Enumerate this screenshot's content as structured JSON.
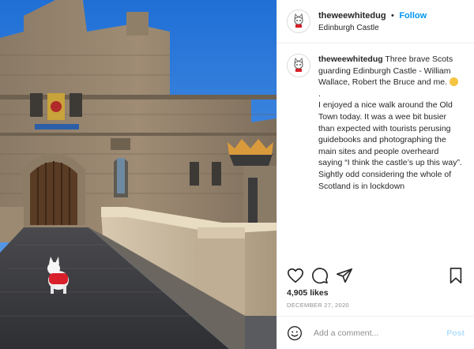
{
  "header": {
    "username": "theweewhitedug",
    "separator": "•",
    "follow_label": "Follow",
    "location": "Edinburgh Castle"
  },
  "caption": {
    "username": "theweewhitedug",
    "line1": "Three brave Scots guarding Edinburgh Castle - William Wallace, Robert the Bruce and me.",
    "line2": ".",
    "line3": "I enjoyed a nice walk around the Old Town today. It was a wee bit busier than expected with tourists perusing guidebooks and photographing the main sites and people overheard saying “I think the castle’s up this way”. Sightly odd considering the whole of Scotland is in lockdown"
  },
  "actions": {
    "icons": [
      "heart-icon",
      "comment-icon",
      "share-icon",
      "bookmark-icon"
    ]
  },
  "likes": "4,905 likes",
  "date": "DECEMBER 27, 2020",
  "add_comment": {
    "placeholder": "Add a comment...",
    "post_label": "Post"
  },
  "colors": {
    "follow": "#0095f6",
    "post_disabled": "#b2dffc",
    "meta_gray": "#8e8e8e",
    "text": "#262626"
  }
}
